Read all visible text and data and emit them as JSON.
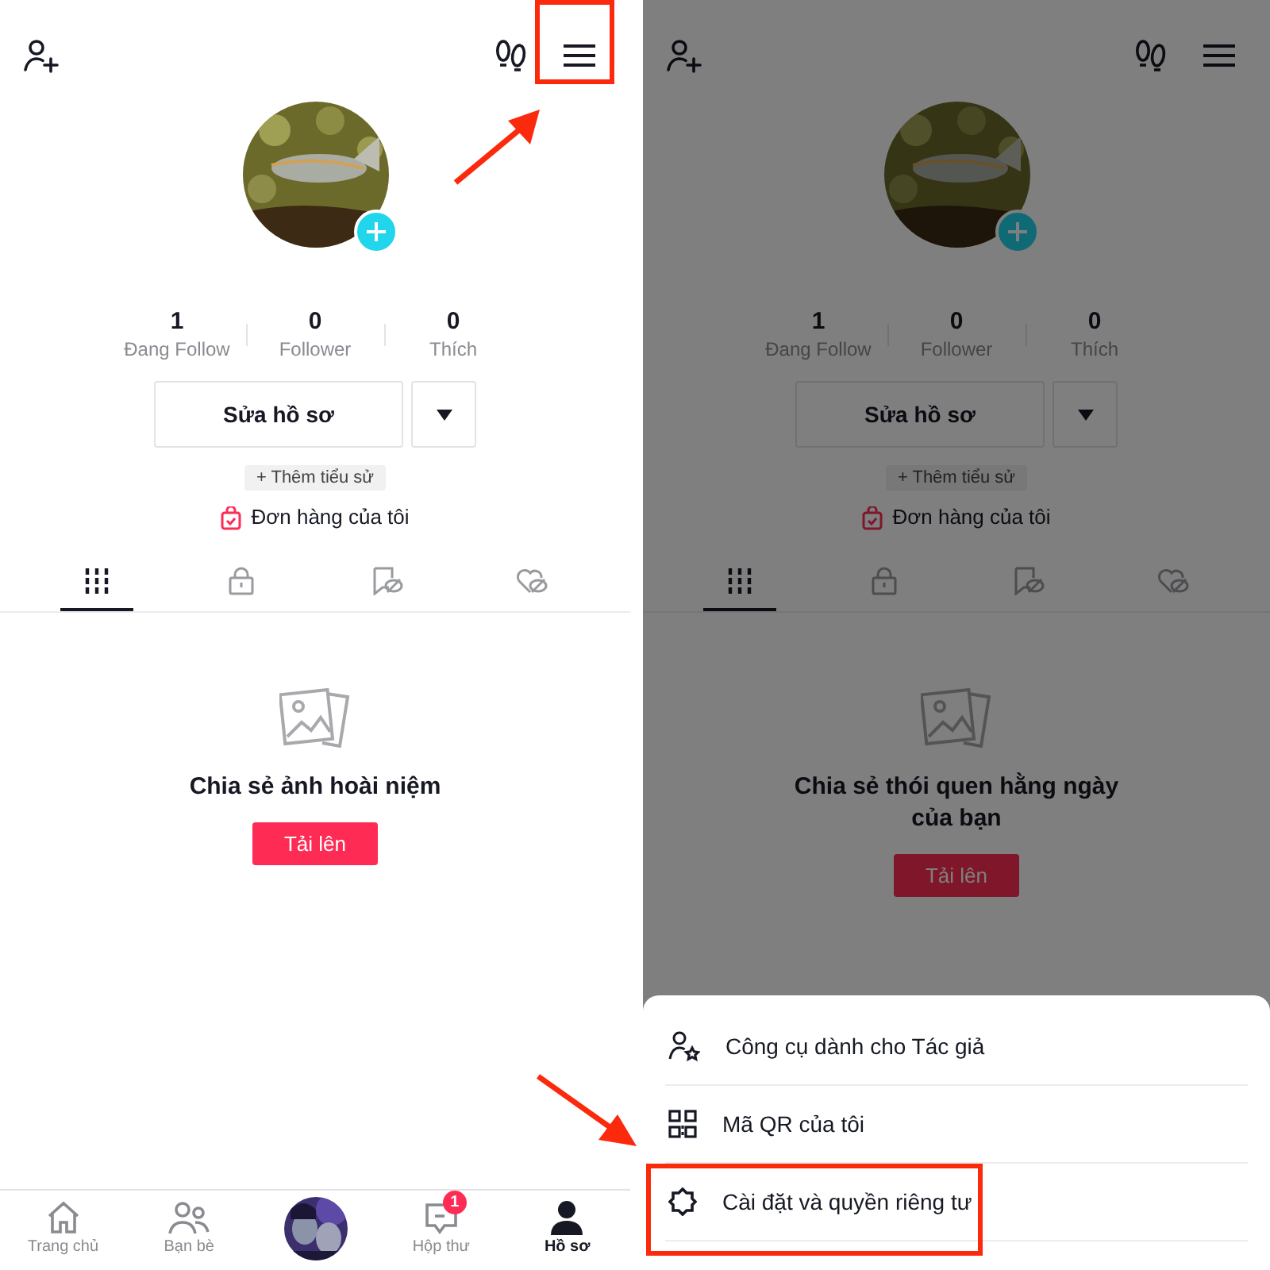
{
  "screens": [
    {
      "dimmed": false,
      "top_bar": {
        "menu_highlighted": true
      },
      "stats": [
        {
          "value": "1",
          "label": "Đang Follow"
        },
        {
          "value": "0",
          "label": "Follower"
        },
        {
          "value": "0",
          "label": "Thích"
        }
      ],
      "edit_button": "Sửa hồ sơ",
      "bio_button": "+ Thêm tiểu sử",
      "orders_link": "Đơn hàng của tôi",
      "tabs": [
        {
          "kind": "videos",
          "selected": true
        },
        {
          "kind": "private",
          "selected": false
        },
        {
          "kind": "saved",
          "selected": false
        },
        {
          "kind": "liked",
          "selected": false
        }
      ],
      "empty_state": {
        "message": "Chia sẻ ảnh hoài niệm",
        "button": "Tải lên"
      },
      "bottom_nav": [
        {
          "kind": "home",
          "label": "Trang chủ",
          "selected": false
        },
        {
          "kind": "friends",
          "label": "Bạn bè",
          "selected": false
        },
        {
          "kind": "create"
        },
        {
          "kind": "inbox",
          "label": "Hộp thư",
          "badge": "1",
          "selected": false
        },
        {
          "kind": "profile",
          "label": "Hồ sơ",
          "selected": true
        }
      ]
    },
    {
      "dimmed": true,
      "top_bar": {
        "menu_highlighted": false
      },
      "stats": [
        {
          "value": "1",
          "label": "Đang Follow"
        },
        {
          "value": "0",
          "label": "Follower"
        },
        {
          "value": "0",
          "label": "Thích"
        }
      ],
      "edit_button": "Sửa hồ sơ",
      "bio_button": "+ Thêm tiểu sử",
      "orders_link": "Đơn hàng của tôi",
      "tabs": [
        {
          "kind": "videos",
          "selected": true
        },
        {
          "kind": "private",
          "selected": false
        },
        {
          "kind": "saved",
          "selected": false
        },
        {
          "kind": "liked",
          "selected": false
        }
      ],
      "empty_state": {
        "message": "Chia sẻ thói quen hằng ngày của bạn",
        "button": "Tải lên"
      },
      "sheet": {
        "items": [
          {
            "kind": "creator",
            "label": "Công cụ dành cho Tác giả",
            "highlighted": false
          },
          {
            "kind": "qr",
            "label": "Mã QR của tôi",
            "highlighted": false
          },
          {
            "kind": "settings",
            "label": "Cài đặt và quyền riêng tư",
            "highlighted": true
          }
        ]
      }
    }
  ]
}
